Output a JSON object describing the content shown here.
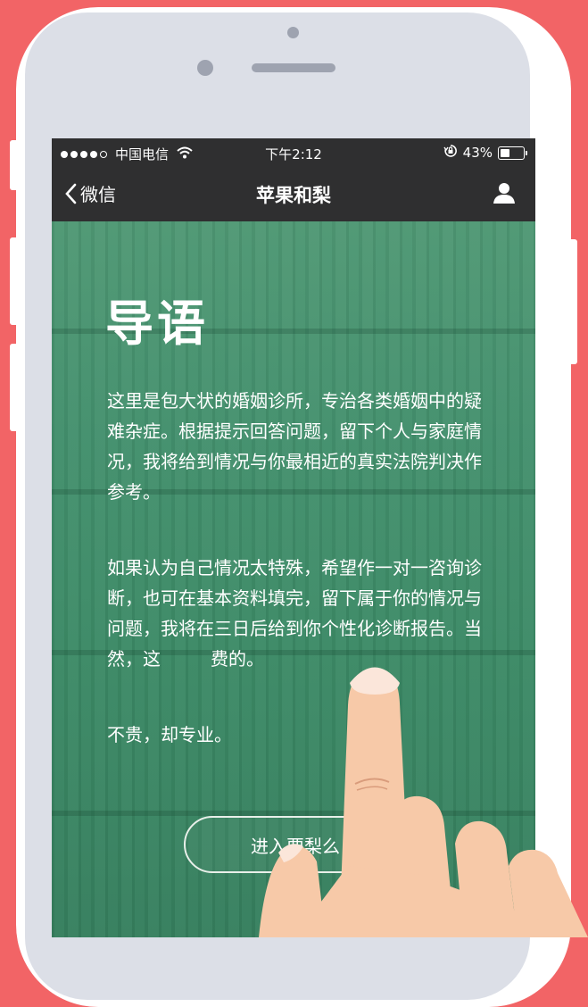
{
  "colors": {
    "background": "#f26466",
    "phone": "#ffffff",
    "bars": "#2f2f30",
    "screen_green": "#3f8a68",
    "hand": "#f7c9a8"
  },
  "status_bar": {
    "signal_dots": 5,
    "signal_filled": 4,
    "carrier": "中国电信",
    "wifi_icon": "wifi-icon",
    "time": "下午2:12",
    "lock_icon": "orientation-lock-icon",
    "battery_text": "43%",
    "battery_level": 0.43
  },
  "nav": {
    "back_label": "微信",
    "title": "苹果和梨",
    "user_icon": "user-icon"
  },
  "content": {
    "heading": "导语",
    "paragraph1": "这里是包大状的婚姻诊所，专治各类婚姻中的疑难杂症。根据提示回答问题，留下个人与家庭情况，我将给到情况与你最相近的真实法院判决作参考。",
    "paragraph2": "如果认为自己情况太特殊，希望作一对一咨询诊断，也可在基本资料填完，留下属于你的情况与问题，我将在三日后给到你个性化诊断报告。当然，这",
    "paragraph2_tail": "费的。",
    "paragraph3": "不贵，却专业。",
    "enter_button": "进入要梨么"
  }
}
